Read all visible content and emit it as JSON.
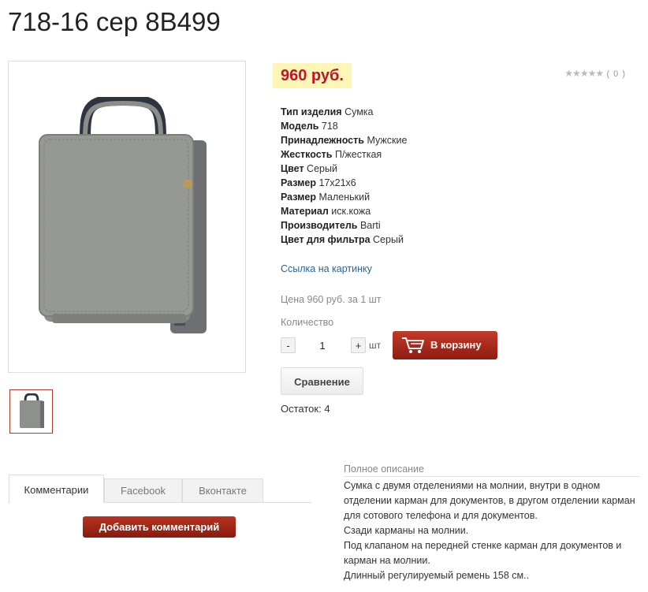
{
  "title": "718-16 сер 8В499",
  "price": "960 руб.",
  "rating": {
    "stars": "★★★★★",
    "count": "( 0 )",
    "value": 0,
    "max": 5
  },
  "specs": [
    {
      "label": "Тип изделия",
      "value": "Сумка"
    },
    {
      "label": "Модель",
      "value": "718"
    },
    {
      "label": "Принадлежность",
      "value": "Мужские"
    },
    {
      "label": "Жесткость",
      "value": "П/жесткая"
    },
    {
      "label": "Цвет",
      "value": "Серый"
    },
    {
      "label": "Размер",
      "value": "17x21x6"
    },
    {
      "label": "Размер",
      "value": "Маленький"
    },
    {
      "label": "Материал",
      "value": "иск.кожа"
    },
    {
      "label": "Производитель",
      "value": "Barti"
    },
    {
      "label": "Цвет для фильтра",
      "value": "Серый"
    }
  ],
  "image_link": "Ссылка на картинку",
  "price_per_unit": "Цена 960 руб. за 1 шт",
  "quantity": {
    "label": "Количество",
    "minus": "-",
    "plus": "+",
    "value": "1",
    "unit": "шт"
  },
  "cart_button": "В корзину",
  "compare_button": "Сравнение",
  "stock": "Остаток: 4",
  "tabs": [
    {
      "label": "Комментарии",
      "active": true
    },
    {
      "label": "Facebook",
      "active": false
    },
    {
      "label": "Вконтакте",
      "active": false
    }
  ],
  "add_comment_button": "Добавить комментарий",
  "description": {
    "title": "Полное описание",
    "paragraphs": [
      "Сумка с двумя отделениями на молнии, внутри в одном отделении карман для документов, в другом отделении карман для сотового телефона и для документов.",
      "Сзади карманы на молнии.",
      "Под клапаном на передней стенке карман для документов и карман на молнии.",
      "Длинный регулируемый ремень 158 см.."
    ]
  },
  "colors": {
    "price_bg": "#fdf6b4",
    "price_text": "#c8102e",
    "accent_button": "#a3281a",
    "link": "#2a6496"
  }
}
